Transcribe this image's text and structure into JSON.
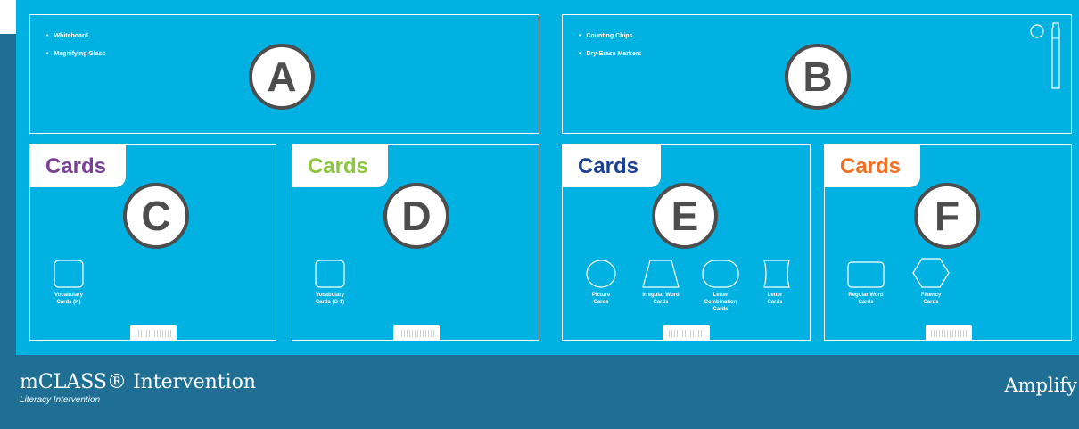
{
  "brand": {
    "name": "mCLASS® Intervention",
    "subtitle": "Literacy Intervention",
    "partner": "Amplify"
  },
  "compartments": {
    "A": {
      "letter": "A",
      "items": [
        "Whiteboard",
        "Magnifying Glass"
      ]
    },
    "B": {
      "letter": "B",
      "items": [
        "Counting Chips",
        "Dry-Erase Markers"
      ]
    },
    "C": {
      "letter": "C",
      "tab": "Cards",
      "tab_color": "#7b3f98",
      "cards": [
        "Vocabulary\nCards (K)"
      ]
    },
    "D": {
      "letter": "D",
      "tab": "Cards",
      "tab_color": "#8cc63f",
      "cards": [
        "Vocabulary\nCards (G 1)"
      ]
    },
    "E": {
      "letter": "E",
      "tab": "Cards",
      "tab_color": "#1b3f94",
      "cards": [
        "Picture\nCards",
        "Irregular Word\nCards",
        "Letter\nCombination\nCards",
        "Letter\nCards"
      ]
    },
    "F": {
      "letter": "F",
      "tab": "Cards",
      "tab_color": "#f26f21",
      "cards": [
        "Regular Word\nCards",
        "Fluency\nCards"
      ]
    }
  },
  "colors": {
    "tray": "#00b1e1",
    "base": "#1f6f95",
    "circle_outline": "#4d4d4d"
  },
  "icons": [
    "circle-chip-icon",
    "marker-icon",
    "square-card-icon",
    "round-card-icon",
    "trapezoid-card-icon",
    "stadium-card-icon",
    "bent-card-icon",
    "rectangle-card-icon",
    "hexagon-card-icon"
  ]
}
